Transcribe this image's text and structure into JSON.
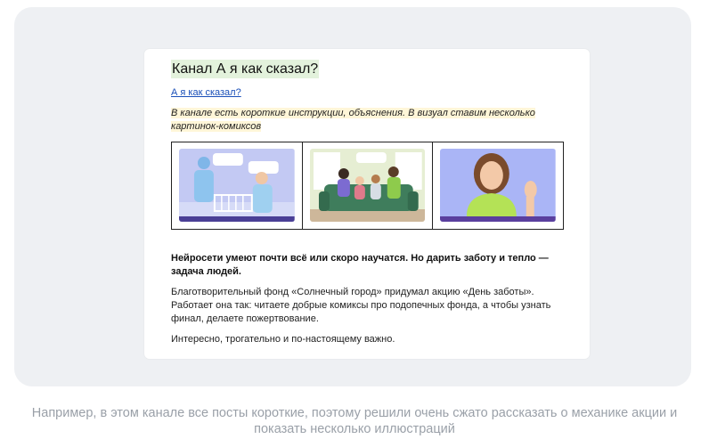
{
  "post": {
    "title": "Канал А я как сказал?",
    "link": "А я как сказал?",
    "intro": "В канале есть короткие инструкции, объяснения. В визуал ставим несколько картинок-комиксов",
    "bold_text": "Нейросети умеют почти всё или скоро научатся. Но дарить заботу и тепло — задача людей.",
    "body_text": "Благотворительный фонд «Солнечный город» придумал акцию «День заботы». Работает она так: читаете добрые комиксы про подопечных фонда, а чтобы узнать финал, делаете пожертвование.",
    "final_text": "Интересно, трогательно и по-настоящему важно."
  },
  "comics": [
    {
      "icon": "comic-doctors-illustration",
      "bg": "#bfc6f2"
    },
    {
      "icon": "comic-family-sofa-illustration",
      "bg": "#dfe9c9"
    },
    {
      "icon": "comic-woman-waving-illustration",
      "bg": "#a9b4f5"
    }
  ],
  "caption": "Например, в этом канале все посты короткие, поэтому решили очень сжато рассказать о механике акции и показать несколько иллюстраций"
}
